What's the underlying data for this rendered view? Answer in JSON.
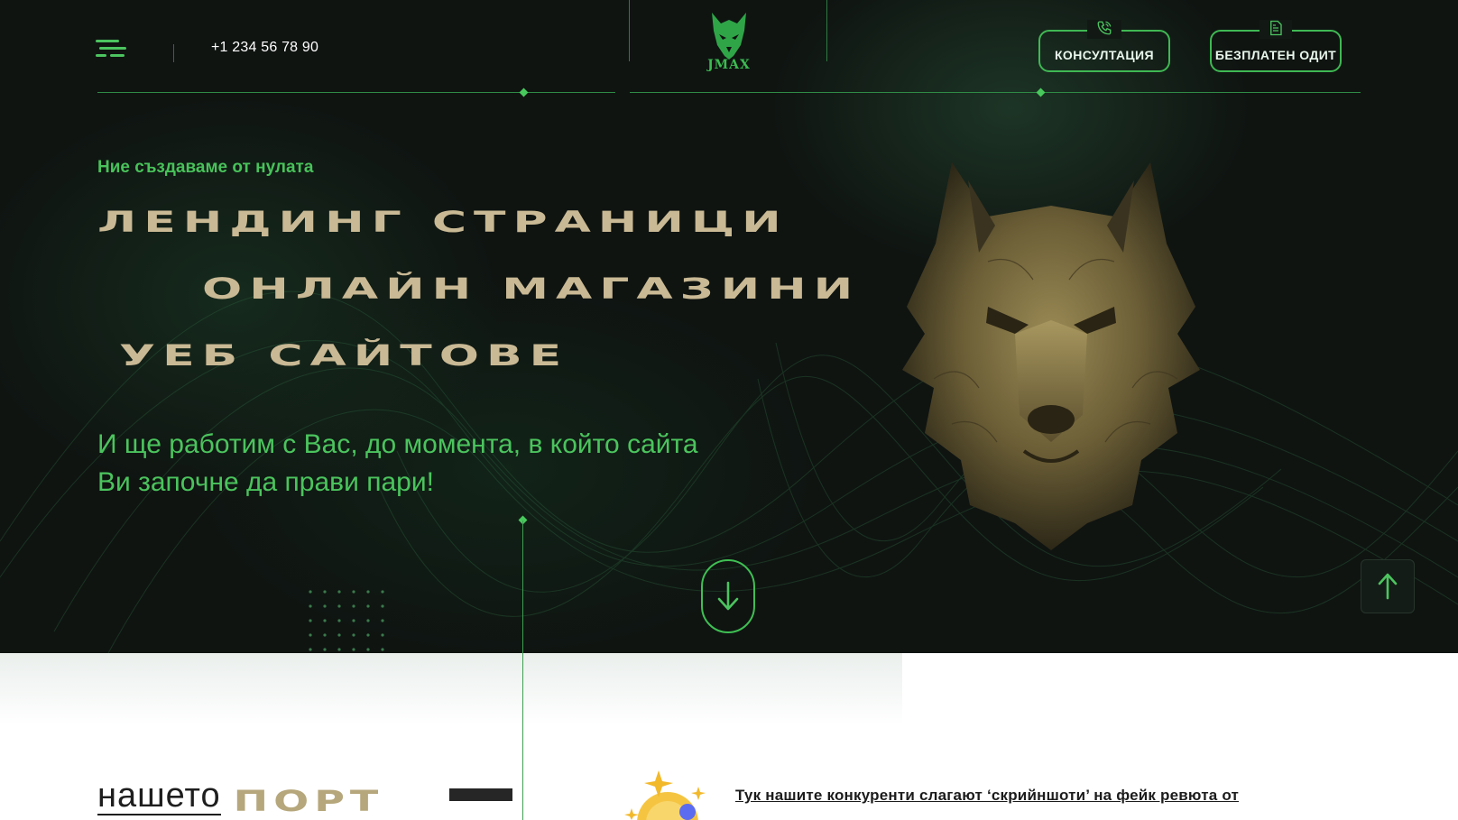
{
  "header": {
    "phone": "+1 234 56 78 90",
    "logo_text": "JMAX",
    "consult_label": "КОНСУЛТАЦИЯ",
    "audit_label": "БЕЗПЛАТЕН ОДИТ"
  },
  "hero": {
    "eyebrow": "Ние създаваме от нулата",
    "lines": [
      "ЛЕНДИНГ СТРАНИЦИ",
      "ОНЛАЙН МАГАЗИНИ",
      "УЕБ САЙТОВЕ"
    ],
    "subtitle": "И ще работим с Вас, до момента, в който сайта Ви започне да прави пари!"
  },
  "portfolio": {
    "word1": "нашето",
    "word2": "ПОРТ"
  },
  "reviews": {
    "text": "Тук нашите конкуренти слагают ‘скрийншоти’ на фейк ревюта от"
  },
  "icons": {
    "menu": "menu-icon",
    "consult": "phone-icon",
    "audit": "document-icon",
    "scroll": "arrow-down-icon",
    "top": "arrow-up-icon",
    "logo": "wolf-logo-icon"
  },
  "colors": {
    "accent": "#4cc45f",
    "headline": "#c9b994",
    "background": "#0f1411"
  }
}
